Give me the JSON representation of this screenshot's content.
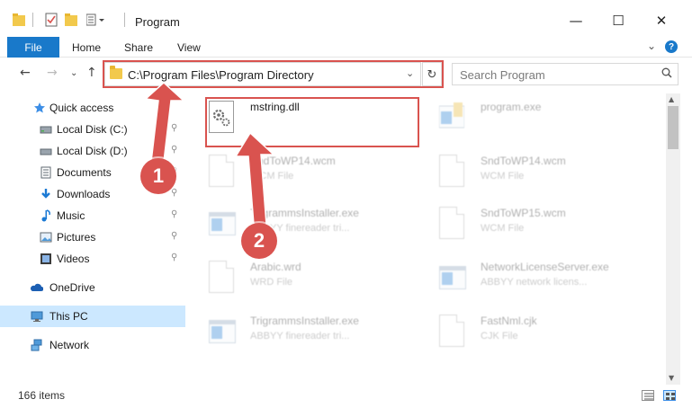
{
  "window": {
    "title": "Program",
    "minimize": "—",
    "maximize": "☐",
    "close": "✕"
  },
  "ribbon": {
    "tabs": [
      "File",
      "Home",
      "Share",
      "View"
    ],
    "expand": "⌄",
    "help": "?"
  },
  "navigation": {
    "back": "←",
    "forward": "→",
    "recent": "⌄",
    "up": "↑",
    "address": "C:\\Program Files\\Program Directory",
    "address_dropdown": "⌄",
    "refresh": "↻",
    "search_placeholder": "Search Program"
  },
  "sidebar": {
    "items": [
      {
        "label": "Quick access",
        "icon": "star-icon",
        "pinned": false
      },
      {
        "label": "Local Disk (C:)",
        "icon": "drive-icon",
        "pinned": true
      },
      {
        "label": "Local Disk (D:)",
        "icon": "drive-icon",
        "pinned": true
      },
      {
        "label": "Documents",
        "icon": "documents-icon",
        "pinned": true
      },
      {
        "label": "Downloads",
        "icon": "download-icon",
        "pinned": true
      },
      {
        "label": "Music",
        "icon": "music-icon",
        "pinned": true
      },
      {
        "label": "Pictures",
        "icon": "pictures-icon",
        "pinned": true
      },
      {
        "label": "Videos",
        "icon": "videos-icon",
        "pinned": true
      },
      {
        "label": "OneDrive",
        "icon": "cloud-icon",
        "pinned": false
      },
      {
        "label": "This PC",
        "icon": "computer-icon",
        "pinned": false,
        "selected": true
      },
      {
        "label": "Network",
        "icon": "network-icon",
        "pinned": false
      }
    ],
    "pin_glyph": "📌"
  },
  "files": [
    {
      "name": "mstring.dll",
      "type": "",
      "icon": "dll-gear-icon",
      "highlighted": true
    },
    {
      "name": "program.exe",
      "type": "",
      "icon": "exe-icon"
    },
    {
      "name": "SndToWP14.wcm",
      "type": "WCM File",
      "icon": "document-icon"
    },
    {
      "name": "SndToWP14.wcm",
      "type": "WCM File",
      "icon": "document-icon"
    },
    {
      "name": "TrigrammsInstaller.exe",
      "type": "ABBYY finereader tri...",
      "icon": "exe-icon"
    },
    {
      "name": "SndToWP15.wcm",
      "type": "WCM File",
      "icon": "document-icon"
    },
    {
      "name": "Arabic.wrd",
      "type": "WRD File",
      "icon": "document-icon"
    },
    {
      "name": "NetworkLicenseServer.exe",
      "type": "ABBYY network licens...",
      "icon": "exe-icon"
    },
    {
      "name": "TrigrammsInstaller.exe",
      "type": "ABBYY finereader tri...",
      "icon": "exe-icon"
    },
    {
      "name": "FastNml.cjk",
      "type": "CJK File",
      "icon": "document-icon"
    }
  ],
  "status": {
    "item_count": "166 items"
  },
  "annotations": {
    "step1": "1",
    "step2": "2",
    "color": "#d9534f"
  }
}
